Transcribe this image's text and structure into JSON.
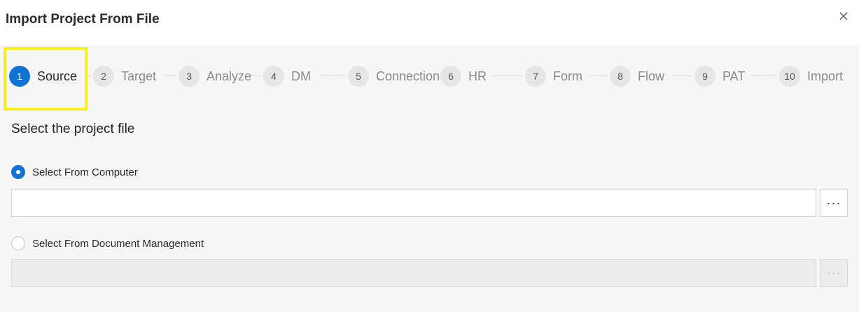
{
  "dialog": {
    "title": "Import Project From File",
    "close_icon": "close-icon"
  },
  "stepper": {
    "steps": [
      {
        "number": "1",
        "label": "Source",
        "active": true
      },
      {
        "number": "2",
        "label": "Target",
        "active": false
      },
      {
        "number": "3",
        "label": "Analyze",
        "active": false
      },
      {
        "number": "4",
        "label": "DM",
        "active": false
      },
      {
        "number": "5",
        "label": "Connections",
        "active": false
      },
      {
        "number": "6",
        "label": "HR",
        "active": false
      },
      {
        "number": "7",
        "label": "Form",
        "active": false
      },
      {
        "number": "8",
        "label": "Flow",
        "active": false
      },
      {
        "number": "9",
        "label": "PAT",
        "active": false
      },
      {
        "number": "10",
        "label": "Import",
        "active": false
      }
    ],
    "accent_color": "#1173d4",
    "highlight_color": "#f6ee1e"
  },
  "source": {
    "title": "Select the project file",
    "option_computer": {
      "label": "Select From Computer",
      "selected": true,
      "value": "",
      "browse_label": "···"
    },
    "option_dm": {
      "label": "Select From Document Management",
      "selected": false,
      "value": "",
      "browse_label": "···"
    }
  }
}
